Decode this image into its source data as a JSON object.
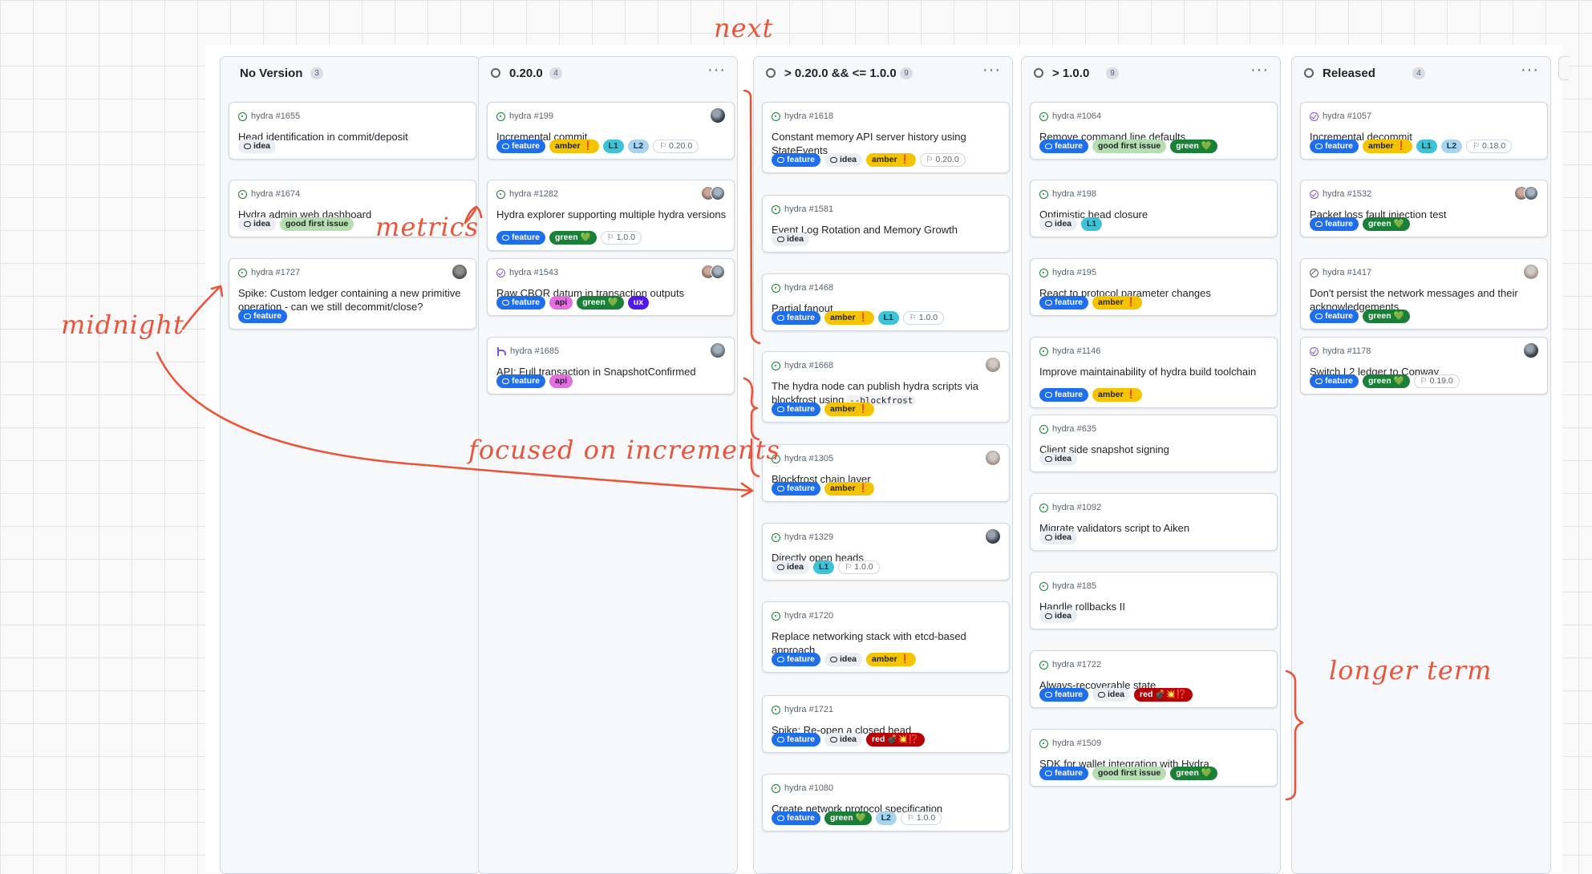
{
  "colors": {
    "annotation": "#e8553c",
    "feature": "#1f6feb",
    "amber": "#f5c400",
    "green": "#1a7f37",
    "red": "#b60205",
    "api": "#e36ee0",
    "ux": "#5319e7",
    "L1": "#3ec3d6",
    "L2": "#aad4ec",
    "good_first_issue": "#b5dfb0",
    "idea": "#eaeef2"
  },
  "columns": [
    {
      "title": "No Version",
      "count": "3",
      "status_icon": false,
      "menu": false,
      "cards": [
        {
          "id": "hydra #1655",
          "state": "open",
          "title": "Head identification in commit/deposit",
          "labels": [
            {
              "t": "idea",
              "k": "idea"
            }
          ]
        },
        {
          "id": "hydra #1674",
          "state": "open",
          "title": "Hydra admin web dashboard",
          "labels": [
            {
              "t": "idea",
              "k": "idea"
            },
            {
              "t": "good first issue",
              "k": "gfi"
            }
          ]
        },
        {
          "id": "hydra #1727",
          "state": "open",
          "avatar": "av-6",
          "title": "Spike: Custom ledger containing a new primitive operation - can we still decommit/close?",
          "labels": [
            {
              "t": "feature",
              "k": "feature"
            }
          ]
        }
      ]
    },
    {
      "title": "0.20.0",
      "count": "4",
      "status_icon": true,
      "menu": true,
      "cards": [
        {
          "id": "hydra #199",
          "state": "open",
          "avatar": "av-1",
          "title": "Incremental commit",
          "labels": [
            {
              "t": "feature",
              "k": "feature"
            },
            {
              "t": "amber ❗",
              "k": "amber"
            },
            {
              "t": "L1",
              "k": "L1"
            },
            {
              "t": "L2",
              "k": "L2"
            },
            {
              "t": "0.20.0",
              "k": "ms"
            }
          ]
        },
        {
          "id": "hydra #1282",
          "state": "open",
          "avatar_pair": true,
          "title": "Hydra explorer supporting multiple hydra versions",
          "labels": [
            {
              "t": "feature",
              "k": "feature"
            },
            {
              "t": "green 💚",
              "k": "green"
            },
            {
              "t": "1.0.0",
              "k": "ms"
            }
          ]
        },
        {
          "id": "hydra #1543",
          "state": "done",
          "avatar_pair": true,
          "title": "Raw CBOR datum in transaction outputs",
          "labels": [
            {
              "t": "feature",
              "k": "feature"
            },
            {
              "t": "api",
              "k": "api"
            },
            {
              "t": "green 💚",
              "k": "green"
            },
            {
              "t": "ux",
              "k": "ux"
            }
          ]
        },
        {
          "id": "hydra #1685",
          "state": "pr",
          "avatar": "av-4",
          "title": "API: Full transaction in SnapshotConfirmed",
          "labels": [
            {
              "t": "feature",
              "k": "feature"
            },
            {
              "t": "api",
              "k": "api"
            }
          ]
        }
      ]
    },
    {
      "title": "> 0.20.0 && <= 1.0.0",
      "count": "9",
      "status_icon": true,
      "menu": true,
      "cards": [
        {
          "id": "hydra #1618",
          "state": "open",
          "title": "Constant memory API server history using StateEvents",
          "labels": [
            {
              "t": "feature",
              "k": "feature"
            },
            {
              "t": "idea",
              "k": "idea"
            },
            {
              "t": "amber ❗",
              "k": "amber"
            },
            {
              "t": "0.20.0",
              "k": "ms"
            }
          ]
        },
        {
          "id": "hydra #1581",
          "state": "open",
          "title": "Event Log Rotation and Memory Growth",
          "labels": [
            {
              "t": "idea",
              "k": "idea"
            }
          ]
        },
        {
          "id": "hydra #1468",
          "state": "open",
          "title": "Partial fanout",
          "labels": [
            {
              "t": "feature",
              "k": "feature"
            },
            {
              "t": "amber ❗",
              "k": "amber"
            },
            {
              "t": "L1",
              "k": "L1"
            },
            {
              "t": "1.0.0",
              "k": "ms"
            }
          ]
        },
        {
          "id": "hydra #1668",
          "state": "open",
          "avatar": "av-5",
          "title": "The hydra node can publish hydra scripts via blockfrost using",
          "title_code": "--blockfrost",
          "labels": [
            {
              "t": "feature",
              "k": "feature"
            },
            {
              "t": "amber ❗",
              "k": "amber"
            }
          ]
        },
        {
          "id": "hydra #1305",
          "state": "open",
          "avatar": "av-5",
          "title": "Blockfrost chain layer",
          "labels": [
            {
              "t": "feature",
              "k": "feature"
            },
            {
              "t": "amber ❗",
              "k": "amber"
            }
          ]
        },
        {
          "id": "hydra #1329",
          "state": "open",
          "avatar": "av-1",
          "title": "Directly open heads",
          "labels": [
            {
              "t": "idea",
              "k": "idea"
            },
            {
              "t": "L1",
              "k": "L1"
            },
            {
              "t": "1.0.0",
              "k": "ms"
            }
          ]
        },
        {
          "id": "hydra #1720",
          "state": "open",
          "title": "Replace networking stack with etcd-based approach",
          "labels": [
            {
              "t": "feature",
              "k": "feature"
            },
            {
              "t": "idea",
              "k": "idea"
            },
            {
              "t": "amber ❗",
              "k": "amber"
            }
          ]
        },
        {
          "id": "hydra #1721",
          "state": "open",
          "title": "Spike: Re-open a closed head",
          "labels": [
            {
              "t": "feature",
              "k": "feature"
            },
            {
              "t": "idea",
              "k": "idea"
            },
            {
              "t": "red 💣💥⁉️",
              "k": "red"
            }
          ]
        },
        {
          "id": "hydra #1080",
          "state": "open",
          "title": "Create network protocol specification",
          "labels": [
            {
              "t": "feature",
              "k": "feature"
            },
            {
              "t": "green 💚",
              "k": "green"
            },
            {
              "t": "L2",
              "k": "L2"
            },
            {
              "t": "1.0.0",
              "k": "ms"
            }
          ]
        }
      ]
    },
    {
      "title": "> 1.0.0",
      "count": "9",
      "status_icon": true,
      "menu": true,
      "cards": [
        {
          "id": "hydra #1064",
          "state": "open",
          "title": "Remove command line defaults",
          "labels": [
            {
              "t": "feature",
              "k": "feature"
            },
            {
              "t": "good first issue",
              "k": "gfi"
            },
            {
              "t": "green 💚",
              "k": "green"
            }
          ]
        },
        {
          "id": "hydra #198",
          "state": "open",
          "title": "Optimistic head closure",
          "labels": [
            {
              "t": "idea",
              "k": "idea"
            },
            {
              "t": "L1",
              "k": "L1"
            }
          ]
        },
        {
          "id": "hydra #195",
          "state": "open",
          "title": "React to protocol parameter changes",
          "labels": [
            {
              "t": "feature",
              "k": "feature"
            },
            {
              "t": "amber ❗",
              "k": "amber"
            }
          ]
        },
        {
          "id": "hydra #1146",
          "state": "open",
          "title": "Improve maintainability of hydra build toolchain",
          "labels": [
            {
              "t": "feature",
              "k": "feature"
            },
            {
              "t": "amber ❗",
              "k": "amber"
            }
          ]
        },
        {
          "id": "hydra #635",
          "state": "open",
          "title": "Client side snapshot signing",
          "labels": [
            {
              "t": "idea",
              "k": "idea"
            }
          ]
        },
        {
          "id": "hydra #1092",
          "state": "open",
          "title": "Migrate validators script to Aiken",
          "labels": [
            {
              "t": "idea",
              "k": "idea"
            }
          ]
        },
        {
          "id": "hydra #185",
          "state": "open",
          "title": "Handle rollbacks II",
          "labels": [
            {
              "t": "idea",
              "k": "idea"
            }
          ]
        },
        {
          "id": "hydra #1722",
          "state": "open",
          "title": "Always-recoverable state",
          "labels": [
            {
              "t": "feature",
              "k": "feature"
            },
            {
              "t": "idea",
              "k": "idea"
            },
            {
              "t": "red 💣💥⁉️",
              "k": "red"
            }
          ]
        },
        {
          "id": "hydra #1509",
          "state": "open",
          "title": "SDK for wallet integration with Hydra",
          "labels": [
            {
              "t": "feature",
              "k": "feature"
            },
            {
              "t": "good first issue",
              "k": "gfi"
            },
            {
              "t": "green 💚",
              "k": "green"
            }
          ]
        }
      ]
    },
    {
      "title": "Released",
      "count": "4",
      "status_icon": true,
      "menu": true,
      "cards": [
        {
          "id": "hydra #1057",
          "state": "done",
          "title": "Incremental decommit",
          "labels": [
            {
              "t": "feature",
              "k": "feature"
            },
            {
              "t": "amber ❗",
              "k": "amber"
            },
            {
              "t": "L1",
              "k": "L1"
            },
            {
              "t": "L2",
              "k": "L2"
            },
            {
              "t": "0.18.0",
              "k": "ms"
            }
          ]
        },
        {
          "id": "hydra #1532",
          "state": "done",
          "avatar_pair": true,
          "title": "Packet loss fault injection test",
          "labels": [
            {
              "t": "feature",
              "k": "feature"
            },
            {
              "t": "green 💚",
              "k": "green"
            }
          ]
        },
        {
          "id": "hydra #1417",
          "state": "notplanned",
          "avatar": "av-5",
          "title": "Don't persist the network messages and their acknowledgements",
          "labels": [
            {
              "t": "feature",
              "k": "feature"
            },
            {
              "t": "green 💚",
              "k": "green"
            }
          ]
        },
        {
          "id": "hydra #1178",
          "state": "done",
          "avatar": "av-1",
          "title": "Switch L2 ledger to Conway",
          "labels": [
            {
              "t": "feature",
              "k": "feature"
            },
            {
              "t": "green 💚",
              "k": "green"
            },
            {
              "t": "0.19.0",
              "k": "ms"
            }
          ]
        }
      ]
    }
  ],
  "annotations": {
    "next": "next",
    "metrics": "metrics",
    "midnight": "midnight",
    "focused": "focused on increments",
    "longer": "longer term"
  }
}
